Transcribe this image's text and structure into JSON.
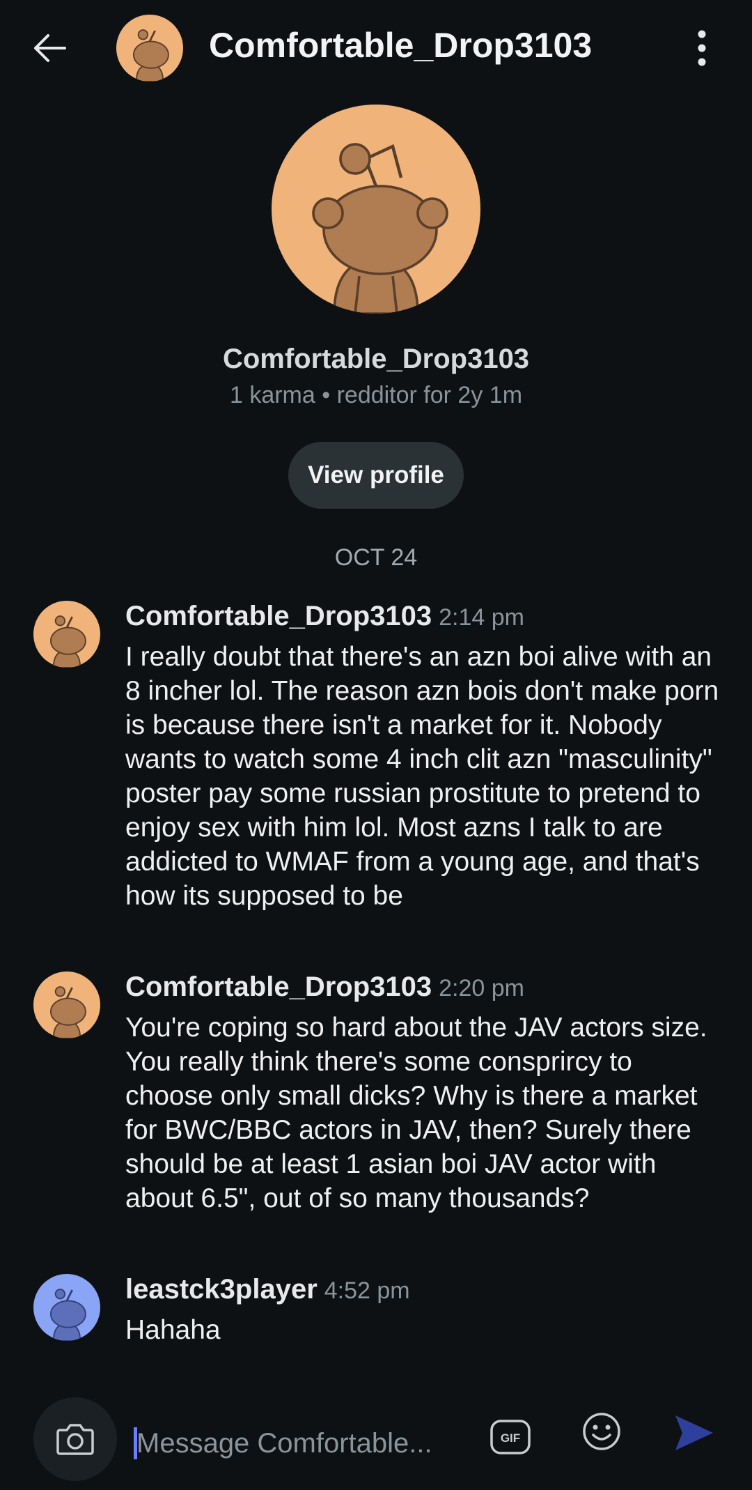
{
  "header": {
    "title": "Comfortable_Drop3103",
    "back_icon": "arrow-left-icon",
    "more_icon": "more-vertical-icon"
  },
  "profile": {
    "name": "Comfortable_Drop3103",
    "meta": "1 karma • redditor for 2y 1m",
    "view_profile_label": "View profile"
  },
  "date_separator": "OCT 24",
  "messages": [
    {
      "author": "Comfortable_Drop3103",
      "time": "2:14 pm",
      "text": "I really doubt that there's an azn boi alive with an 8 incher lol. The reason azn bois don't make porn is because there isn't a market for it. Nobody wants to watch some 4 inch clit azn \"masculinity\" poster pay some russian prostitute to pretend to enjoy sex with him lol. Most azns I talk to are addicted to WMAF from a young age, and that's how its supposed to be",
      "avatar_color": "#f0b47a"
    },
    {
      "author": "Comfortable_Drop3103",
      "time": "2:20 pm",
      "text": "You're coping so hard about the JAV actors size. You really think there's some consprircy to choose only small dicks? Why is there a market for BWC/BBC actors in JAV, then? Surely there should be at least 1 asian boi JAV actor with about 6.5\", out of so many thousands?",
      "avatar_color": "#f0b47a"
    },
    {
      "author": "leastck3player",
      "time": "4:52 pm",
      "text": "Hahaha",
      "avatar_color": "#8aa5f5"
    }
  ],
  "composer": {
    "placeholder": "Message Comfortable...",
    "camera_icon": "camera-icon",
    "gif_icon": "gif-icon",
    "emoji_icon": "emoji-icon",
    "send_icon": "send-icon"
  },
  "colors": {
    "background": "#0e1113",
    "button": "#2a3236",
    "secondary_text": "#8a949b",
    "accent_send": "#3a4fd6"
  }
}
